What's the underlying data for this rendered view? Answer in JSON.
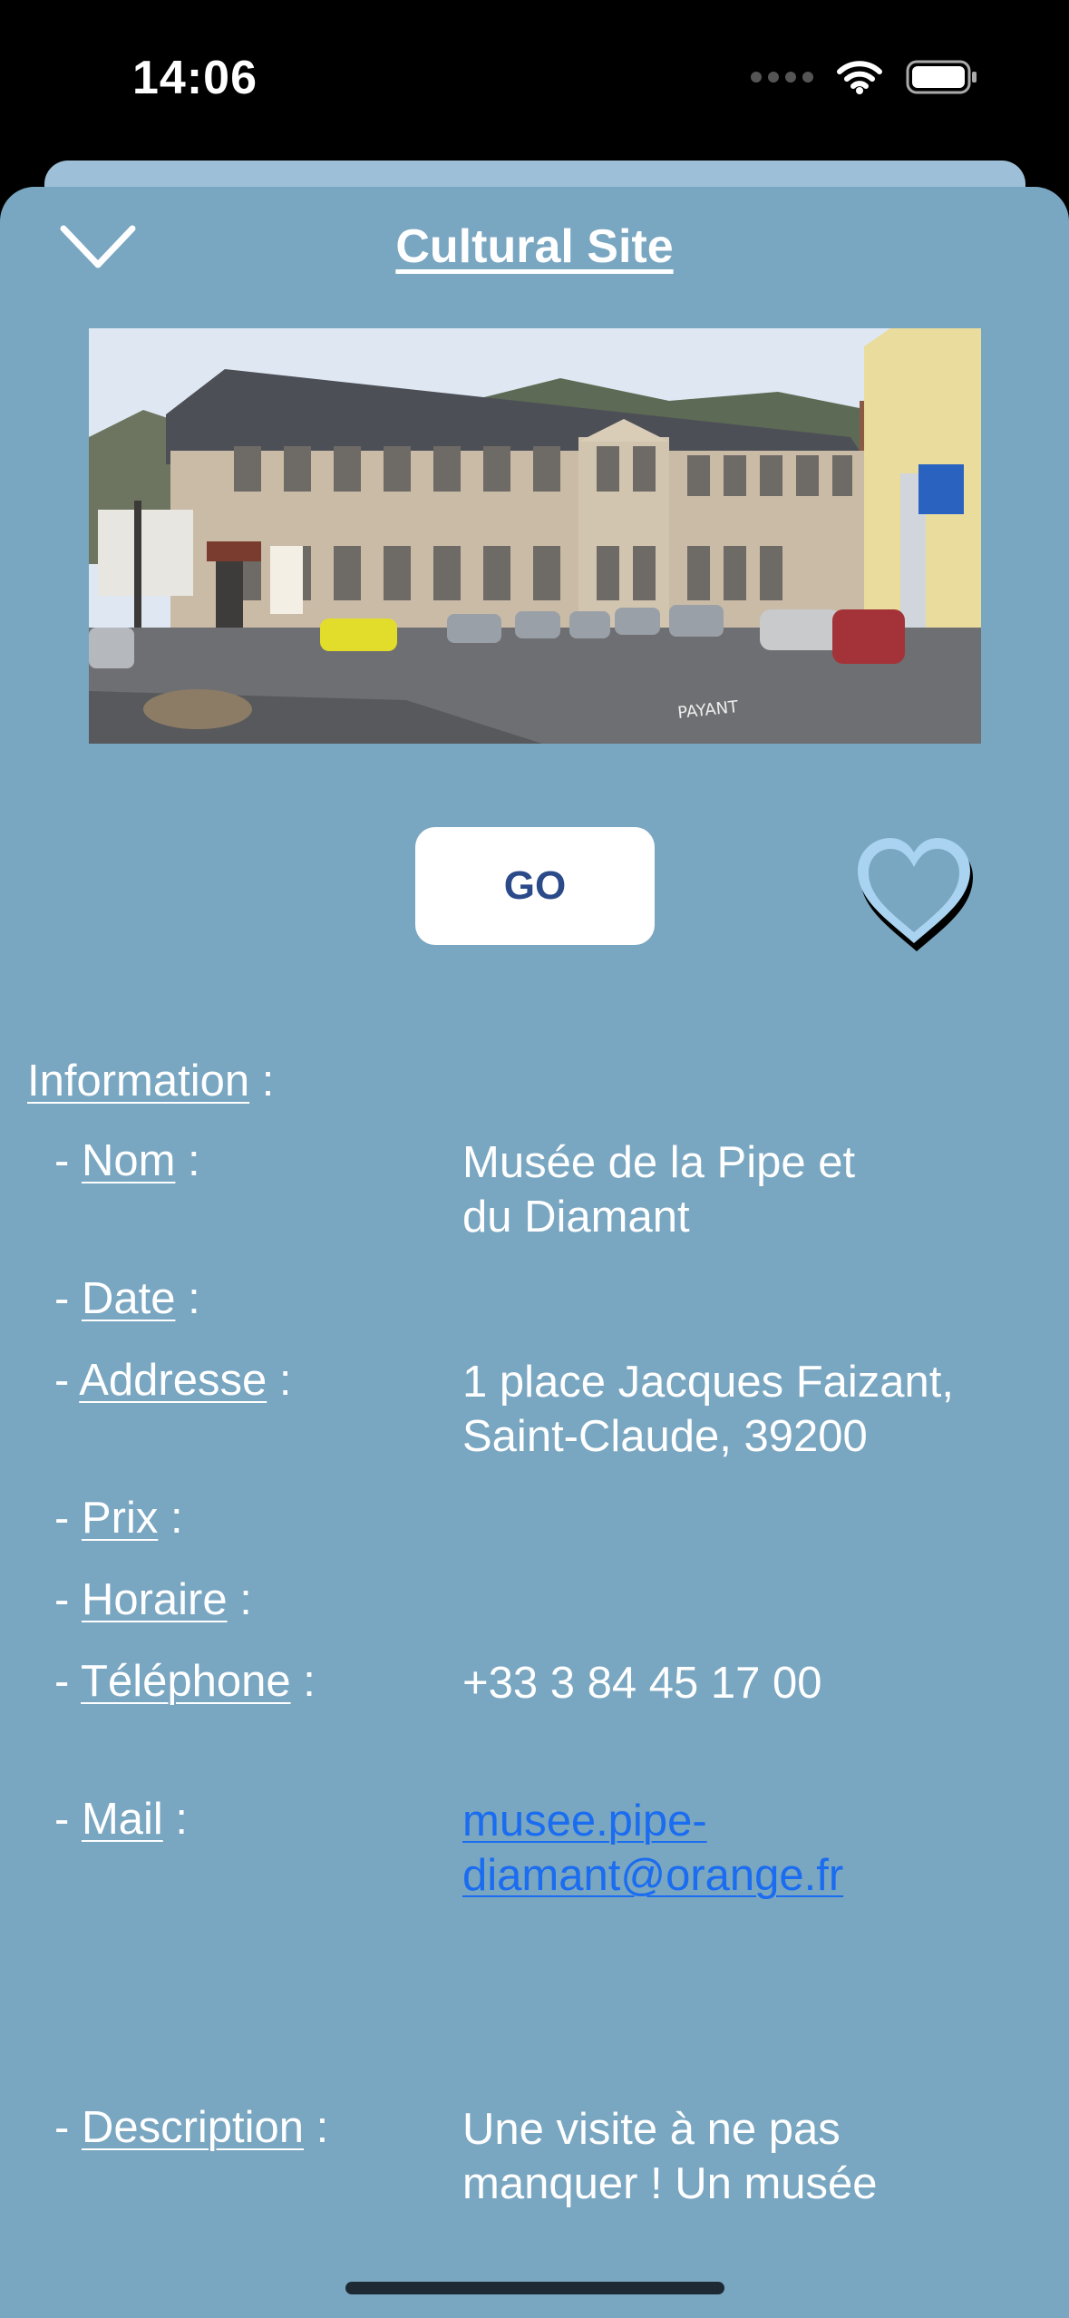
{
  "status_bar": {
    "time": "14:06"
  },
  "header": {
    "title": "Cultural Site"
  },
  "actions": {
    "go_label": "GO"
  },
  "info": {
    "section_title": "Information",
    "section_suffix": " :",
    "nom": {
      "label": "Nom",
      "suffix": " :",
      "value_line1": "Musée de la Pipe et",
      "value_line2": "du Diamant"
    },
    "date": {
      "label": "Date",
      "suffix": " :"
    },
    "adresse": {
      "label": "Addresse",
      "suffix": " :",
      "value_line1": "1 place Jacques Faizant,",
      "value_line2": "Saint-Claude, 39200"
    },
    "prix": {
      "label": "Prix",
      "suffix": " :"
    },
    "horaire": {
      "label": "Horaire",
      "suffix": " :"
    },
    "telephone": {
      "label": "Téléphone",
      "suffix": " :",
      "value": "+33 3 84 45 17 00"
    },
    "mail": {
      "label": "Mail",
      "suffix": " :",
      "value_line1": "musee.pipe-",
      "value_line2": "diamant@orange.fr"
    },
    "description": {
      "label": "Description",
      "suffix": " :",
      "value_line1": "Une visite à ne pas",
      "value_line2": "manquer ! Un musée"
    }
  },
  "colors": {
    "sheet_bg": "#79a6c1",
    "back_sheet": "#9dc0d8",
    "link": "#1a6cf0",
    "go_text": "#2b4a8a",
    "heart_fill": "#a9d3f0"
  },
  "icons": {
    "dismiss": "chevron-down-icon",
    "favorite": "heart-outline-icon",
    "wifi": "wifi-icon",
    "battery": "battery-icon"
  }
}
